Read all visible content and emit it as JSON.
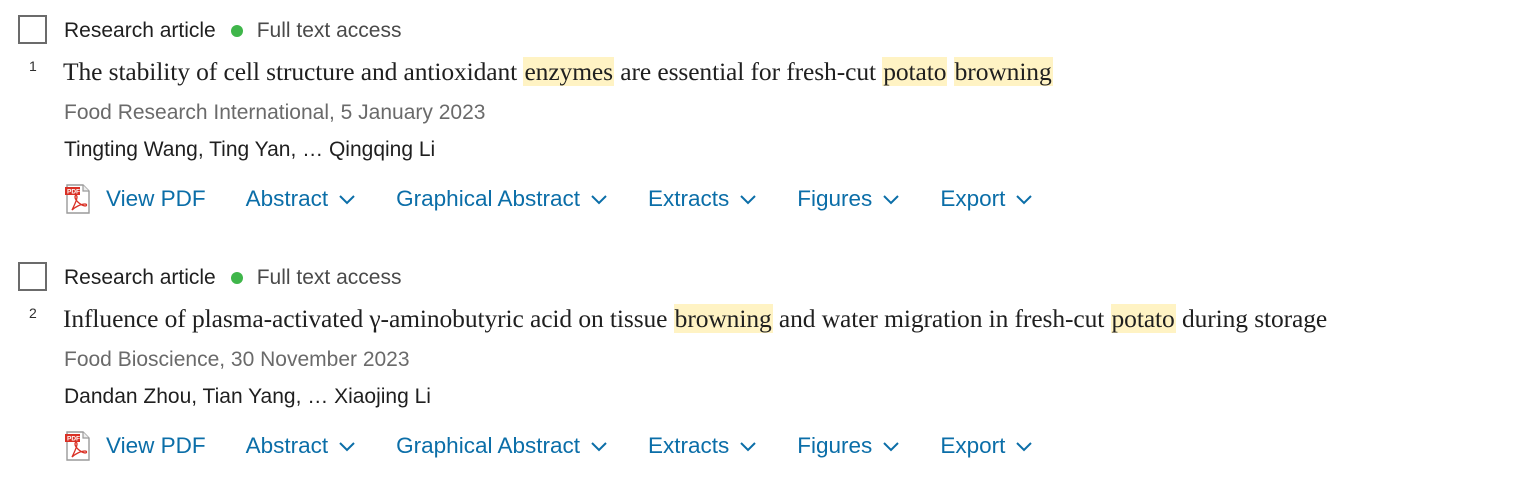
{
  "colors": {
    "link": "#0b6ea8",
    "highlight": "#fff3c4",
    "access_dot": "#3fb64a",
    "pdf_red": "#d93025"
  },
  "icons": {
    "checkbox": "checkbox-icon",
    "access": "green-dot-icon",
    "pdf": "pdf-file-icon",
    "expand": "chevron-down-icon"
  },
  "results": [
    {
      "index": "1",
      "type": "Research article",
      "access": "Full text access",
      "title_parts": [
        {
          "text": "The stability of cell structure and antioxidant ",
          "hl": false
        },
        {
          "text": "enzymes",
          "hl": true
        },
        {
          "text": " are essential for fresh-cut ",
          "hl": false
        },
        {
          "text": "potato",
          "hl": true
        },
        {
          "text": " ",
          "hl": false
        },
        {
          "text": "browning",
          "hl": true
        }
      ],
      "source": "Food Research International, 5 January 2023",
      "authors": "Tingting Wang, Ting Yan, … Qingqing Li",
      "actions": {
        "view_pdf": "View PDF",
        "abstract": "Abstract",
        "graphical_abstract": "Graphical Abstract",
        "extracts": "Extracts",
        "figures": "Figures",
        "export": "Export"
      }
    },
    {
      "index": "2",
      "type": "Research article",
      "access": "Full text access",
      "title_parts": [
        {
          "text": "Influence of plasma-activated γ-aminobutyric acid on tissue ",
          "hl": false
        },
        {
          "text": "browning",
          "hl": true
        },
        {
          "text": " and water migration in fresh-cut ",
          "hl": false
        },
        {
          "text": "potato",
          "hl": true
        },
        {
          "text": " during storage",
          "hl": false
        }
      ],
      "source": "Food Bioscience, 30 November 2023",
      "authors": "Dandan Zhou, Tian Yang, … Xiaojing Li",
      "actions": {
        "view_pdf": "View PDF",
        "abstract": "Abstract",
        "graphical_abstract": "Graphical Abstract",
        "extracts": "Extracts",
        "figures": "Figures",
        "export": "Export"
      }
    }
  ]
}
